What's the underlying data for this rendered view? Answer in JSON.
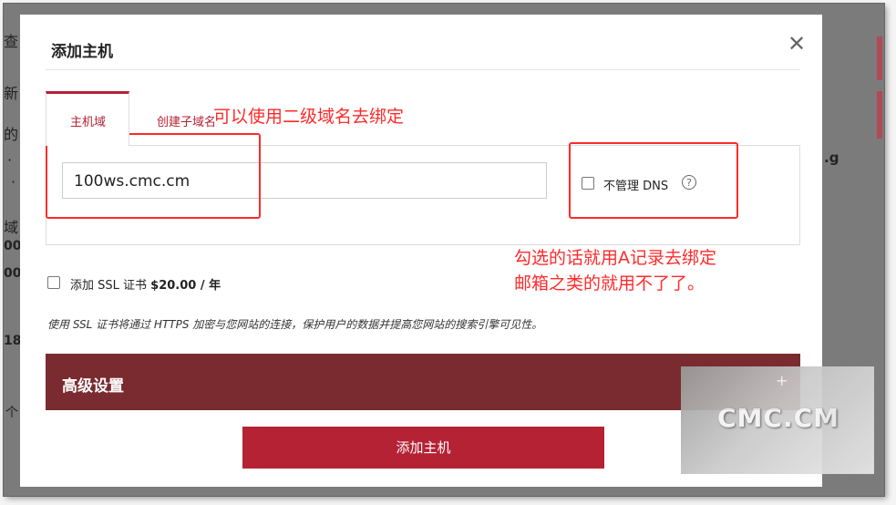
{
  "background": {
    "left_fragments": [
      "查",
      "新",
      "的",
      "·",
      "·",
      "域",
      "00",
      "00",
      "18",
      "个"
    ],
    "right_fragment": ".g"
  },
  "modal": {
    "title": "添加主机",
    "close_glyph": "✕",
    "tabs": [
      {
        "label": "主机域",
        "active": true
      },
      {
        "label": "创建子域名",
        "active": false
      }
    ],
    "host_input_value": "100ws.cmc.cm",
    "dns_checkbox_label": "不管理 DNS",
    "dns_checkbox_checked": false,
    "help_glyph": "?",
    "ssl_checkbox_label": "添加 SSL 证书",
    "ssl_price": "$20.00 / 年",
    "ssl_checkbox_checked": false,
    "ssl_description": "使用 SSL 证书将通过 HTTPS 加密与您网站的连接，保护用户的数据并提高您网站的搜索引擎可见性。",
    "advanced_label": "高级设置",
    "submit_label": "添加主机"
  },
  "annotations": {
    "subdomain_note": "可以使用二级域名去绑定",
    "dns_note_line1": "勾选的话就用A记录去绑定",
    "dns_note_line2": "邮箱之类的就用不了了。"
  },
  "watermark": {
    "text": "CMC.CM",
    "plus": "+"
  },
  "colors": {
    "accent": "#b52234",
    "advanced_bar": "#7a2b2f",
    "annotation": "#ff2a2a"
  }
}
